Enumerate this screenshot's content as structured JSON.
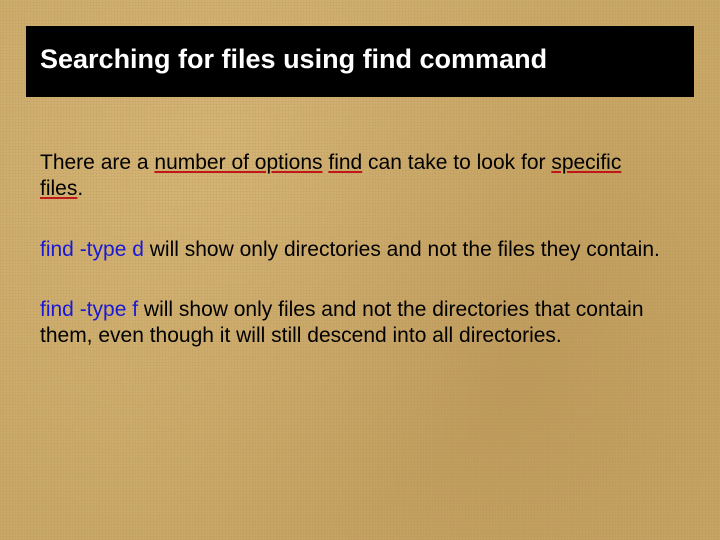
{
  "title": "Searching for files using find command",
  "intro": {
    "t1": "There are a ",
    "t2": "number of options",
    "t3": " ",
    "t4": "find",
    "t5": " can take to look for ",
    "t6": "specific",
    "t7": "files",
    "t8": "."
  },
  "p2": {
    "cmd": "find -type d",
    "rest": "   will show only directories and not the files they contain."
  },
  "p3": {
    "cmd": "find -type f",
    "rest": "    will show only files and not the directories that contain them, even though it will still descend into all directories."
  }
}
